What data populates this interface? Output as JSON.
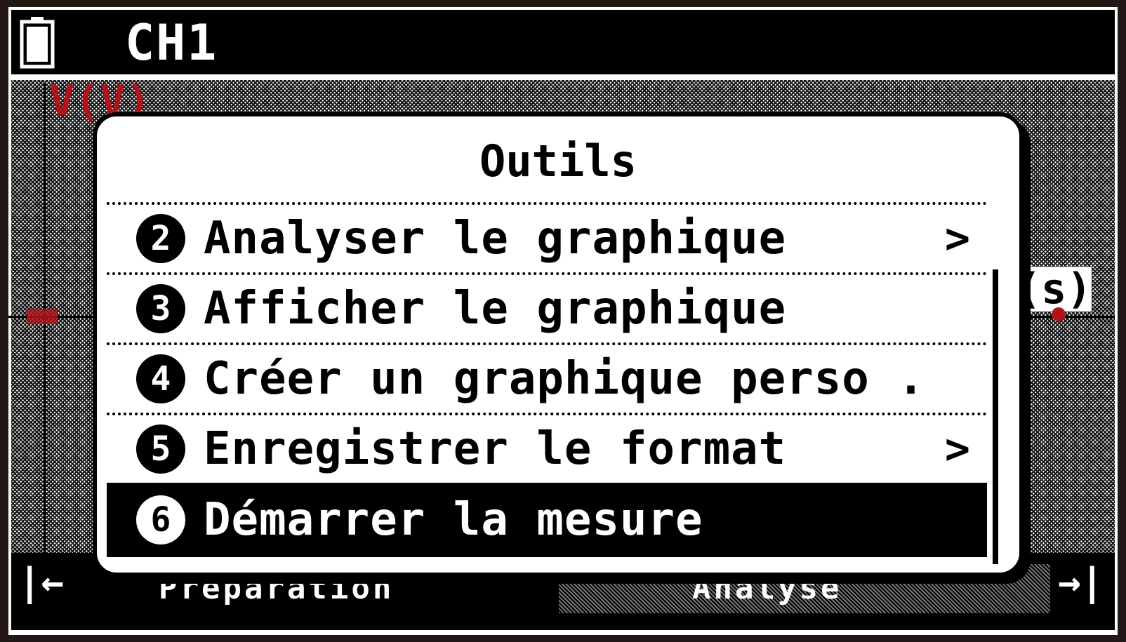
{
  "header": {
    "channel": "CH1"
  },
  "plot": {
    "y_axis_label": "V(V)",
    "x_axis_label": "(s)",
    "accent_color": "#b0141a"
  },
  "bottom_bar": {
    "left_nav": "|←",
    "right_nav": "→|",
    "tab_left": "Préparation",
    "tab_right": "Analyse"
  },
  "dialog": {
    "title": "Outils",
    "items": [
      {
        "number": "2",
        "label": "Analyser le graphique",
        "chevron": ">"
      },
      {
        "number": "3",
        "label": "Afficher le graphique",
        "chevron": ""
      },
      {
        "number": "4",
        "label": "Créer un graphique perso .",
        "chevron": ""
      },
      {
        "number": "5",
        "label": "Enregistrer le format",
        "chevron": ">"
      },
      {
        "number": "6",
        "label": "Démarrer la mesure",
        "chevron": "",
        "selected": true
      }
    ]
  }
}
